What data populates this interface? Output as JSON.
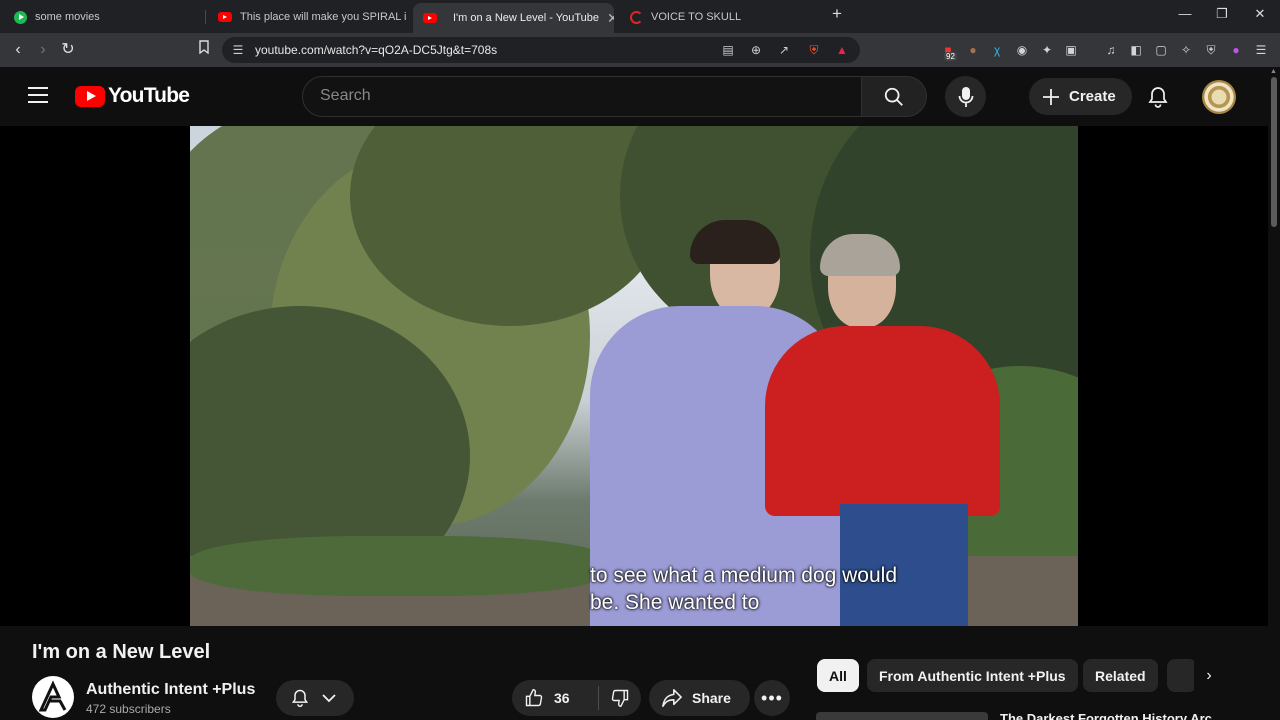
{
  "browser": {
    "tabs": [
      {
        "label": "some movies",
        "icon": "play-icon"
      },
      {
        "label": "This place will make you SPIRAL into",
        "icon": "youtube-icon"
      },
      {
        "label": "I'm on a New Level - YouTube",
        "icon": "youtube-icon",
        "active": true,
        "audio": true
      },
      {
        "label": "VOICE TO SKULL",
        "icon": "circle-icon"
      }
    ],
    "new_tab_label": "+",
    "url": "youtube.com/watch?v=qO2A-DC5Jtg&t=708s",
    "extension_badge": "92"
  },
  "header": {
    "logo_text": "YouTube",
    "search_placeholder": "Search",
    "create_label": "Create"
  },
  "video": {
    "caption_line1": "to see what a medium dog would",
    "caption_line2": "be. She wanted to"
  },
  "info": {
    "title": "I'm on a New Level",
    "channel_name": "Authentic Intent +Plus",
    "subscribers": "472 subscribers",
    "like_count": "36",
    "share_label": "Share",
    "more_label": "•••"
  },
  "chips": [
    {
      "label": "All",
      "selected": true
    },
    {
      "label": "From Authentic Intent +Plus",
      "selected": false
    },
    {
      "label": "Related",
      "selected": false
    }
  ],
  "next_video_title": "The Darkest Forgotten History Arc",
  "colors": {
    "youtube_red": "#ff0000",
    "background": "#0f0f0f",
    "chip_selected_bg": "#f1f1f1"
  }
}
